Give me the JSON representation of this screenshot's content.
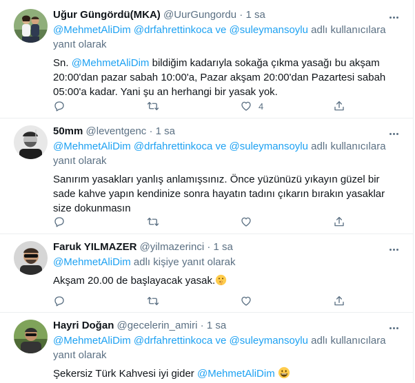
{
  "tweets": [
    {
      "name": "Uğur Güngördü(MKA)",
      "handle": "@UurGungordu",
      "dot": "·",
      "time": "1 sa",
      "reply_mentions": "@MehmetAliDim @drfahrettinkoca ve @suleymansoylu",
      "reply_suffix": " adlı kullanıcılara yanıt olarak",
      "text_prefix": "Sn. ",
      "text_mention": "@MehmetAliDim",
      "text_body": " bildiğim kadarıyla sokağa çıkma yasağı bu akşam 20:00'dan pazar sabah 10:00'a, Pazar akşam 20:00'dan Pazartesi sabah 05:00'a kadar. Yani şu an herhangi bir yasak yok.",
      "like_count": "4"
    },
    {
      "name": "50mm",
      "handle": "@leventgenc",
      "dot": "·",
      "time": "1 sa",
      "reply_mentions": "@MehmetAliDim @drfahrettinkoca ve @suleymansoylu",
      "reply_suffix": " adlı kullanıcılara yanıt olarak",
      "text": "Sanırım yasakları yanlış anlamışsınız. Önce yüzünüzü yıkayın güzel bir sade kahve yapın kendinize sonra hayatın tadını çıkarın bırakın yasaklar size dokunmasın"
    },
    {
      "name": "Faruk YILMAZER",
      "handle": "@yilmazerinci",
      "dot": "·",
      "time": "1 sa",
      "reply_mentions": "@MehmetAliDim",
      "reply_suffix": " adlı kişiye yanıt olarak",
      "text": "Akşam 20.00 de başlayacak yasak.",
      "emoji": "shushing-face-emoji"
    },
    {
      "name": "Hayri Doğan",
      "handle": "@gecelerin_amiri",
      "dot": "·",
      "time": "1 sa",
      "reply_mentions": "@MehmetAliDim @drfahrettinkoca ve @suleymansoylu",
      "reply_suffix": " adlı kullanıcılara yanıt olarak",
      "text_prefix": "Şekersiz Türk Kahvesi iyi gider ",
      "text_mention": "@MehmetAliDim",
      "emoji": "grinning-face-emoji"
    }
  ],
  "icons": [
    "reply-icon",
    "retweet-icon",
    "like-icon",
    "share-icon",
    "more-icon"
  ],
  "colors": {
    "link": "#1da1f2",
    "secondary": "#5b7083",
    "text": "#0f1419",
    "divider": "#ebeef0"
  }
}
